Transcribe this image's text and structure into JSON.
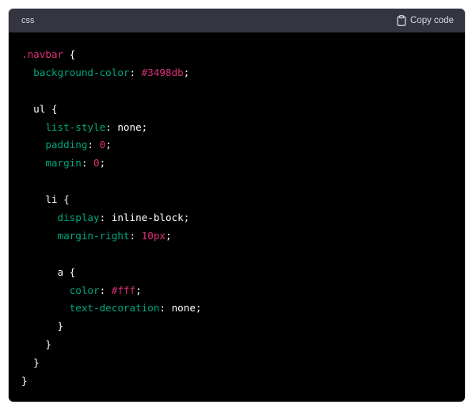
{
  "header": {
    "language": "css",
    "copy_label": "Copy code",
    "copy_icon": "clipboard-icon"
  },
  "colors": {
    "background": "#000000",
    "header_background": "#343541",
    "selector": "#df3079",
    "property": "#00a67d",
    "value_literal": "#df3079",
    "plain": "#ffffff"
  },
  "code_lines": [
    [
      {
        "t": ".navbar",
        "c": "pink"
      },
      {
        "t": " {",
        "c": "white"
      }
    ],
    [
      {
        "t": "  ",
        "c": "white"
      },
      {
        "t": "background-color",
        "c": "green"
      },
      {
        "t": ": ",
        "c": "white"
      },
      {
        "t": "#3498db",
        "c": "pink"
      },
      {
        "t": ";",
        "c": "white"
      }
    ],
    [],
    [
      {
        "t": "  ul {",
        "c": "white"
      }
    ],
    [
      {
        "t": "    ",
        "c": "white"
      },
      {
        "t": "list-style",
        "c": "green"
      },
      {
        "t": ": none;",
        "c": "white"
      }
    ],
    [
      {
        "t": "    ",
        "c": "white"
      },
      {
        "t": "padding",
        "c": "green"
      },
      {
        "t": ": ",
        "c": "white"
      },
      {
        "t": "0",
        "c": "pink"
      },
      {
        "t": ";",
        "c": "white"
      }
    ],
    [
      {
        "t": "    ",
        "c": "white"
      },
      {
        "t": "margin",
        "c": "green"
      },
      {
        "t": ": ",
        "c": "white"
      },
      {
        "t": "0",
        "c": "pink"
      },
      {
        "t": ";",
        "c": "white"
      }
    ],
    [],
    [
      {
        "t": "    li {",
        "c": "white"
      }
    ],
    [
      {
        "t": "      ",
        "c": "white"
      },
      {
        "t": "display",
        "c": "green"
      },
      {
        "t": ": inline-block;",
        "c": "white"
      }
    ],
    [
      {
        "t": "      ",
        "c": "white"
      },
      {
        "t": "margin-right",
        "c": "green"
      },
      {
        "t": ": ",
        "c": "white"
      },
      {
        "t": "10px",
        "c": "pink"
      },
      {
        "t": ";",
        "c": "white"
      }
    ],
    [],
    [
      {
        "t": "      a {",
        "c": "white"
      }
    ],
    [
      {
        "t": "        ",
        "c": "white"
      },
      {
        "t": "color",
        "c": "green"
      },
      {
        "t": ": ",
        "c": "white"
      },
      {
        "t": "#fff",
        "c": "pink"
      },
      {
        "t": ";",
        "c": "white"
      }
    ],
    [
      {
        "t": "        ",
        "c": "white"
      },
      {
        "t": "text-decoration",
        "c": "green"
      },
      {
        "t": ": none;",
        "c": "white"
      }
    ],
    [
      {
        "t": "      }",
        "c": "white"
      }
    ],
    [
      {
        "t": "    }",
        "c": "white"
      }
    ],
    [
      {
        "t": "  }",
        "c": "white"
      }
    ],
    [
      {
        "t": "}",
        "c": "white"
      }
    ]
  ]
}
